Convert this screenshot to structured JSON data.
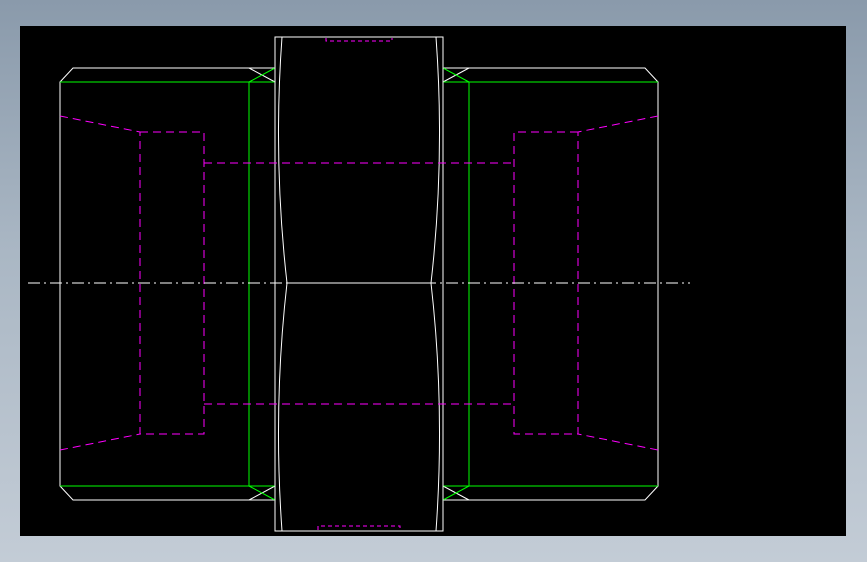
{
  "viewport": {
    "background": "#000000"
  },
  "colors": {
    "visible_edge": "#ffffff",
    "thread_edge": "#00ff00",
    "hidden_edge": "#ff00ff",
    "center_line": "#ffffff"
  }
}
